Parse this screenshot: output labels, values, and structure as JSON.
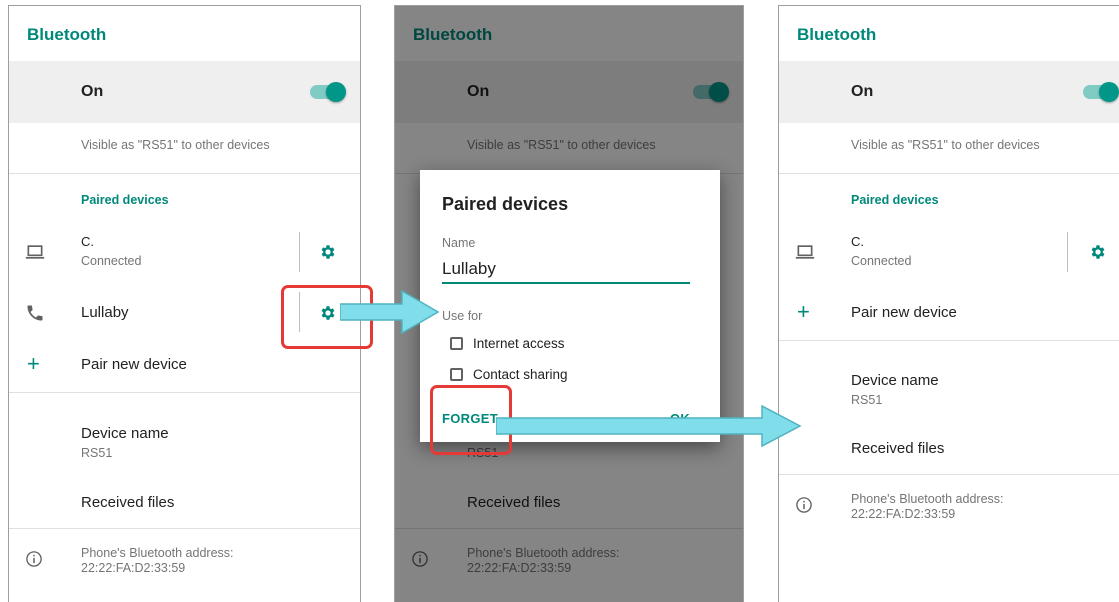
{
  "appbar": {
    "title": "Bluetooth"
  },
  "toggle": {
    "label": "On",
    "state": "on"
  },
  "visible_text": "Visible as \"RS51\" to other devices",
  "paired_section": "Paired devices",
  "devices": [
    {
      "name": "C.",
      "status": "Connected",
      "icon": "laptop-icon"
    },
    {
      "name": "Lullaby",
      "icon": "phone-icon"
    }
  ],
  "pair_new": "Pair new device",
  "device_name": {
    "title": "Device name",
    "value": "RS51"
  },
  "received_files": "Received files",
  "address": {
    "line1": "Phone's Bluetooth address:",
    "line2": "22:22:FA:D2:33:59"
  },
  "dialog": {
    "title": "Paired devices",
    "name_label": "Name",
    "name_value": "Lullaby",
    "use_for_label": "Use for",
    "options": [
      "Internet access",
      "Contact sharing"
    ],
    "forget": "FORGET",
    "ok": "OK"
  },
  "colors": {
    "accent": "#00897b",
    "highlight": "#e53935",
    "arrow": "#80deea"
  }
}
